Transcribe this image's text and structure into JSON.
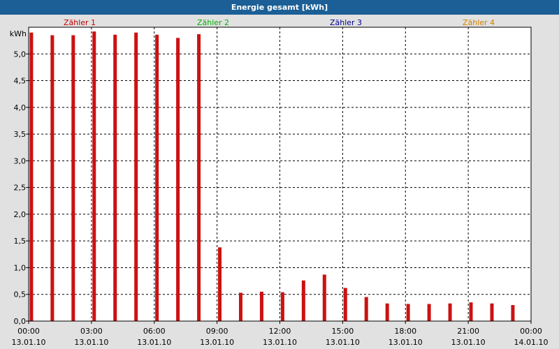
{
  "window": {
    "title": "Energie gesamt [kWh]"
  },
  "legend": [
    {
      "label": "Zähler 1",
      "color": "#c00000"
    },
    {
      "label": "Zähler 2",
      "color": "#00b000"
    },
    {
      "label": "Zähler 3",
      "color": "#000090"
    },
    {
      "label": "Zähler 4",
      "color": "#d08000"
    }
  ],
  "chart_data": {
    "type": "bar",
    "title": "Energie gesamt [kWh]",
    "ylabel": "kWh",
    "ylim": [
      0,
      5.5
    ],
    "ytick_labels": [
      "0,0",
      "0,5",
      "1,0",
      "1,5",
      "2,0",
      "2,5",
      "3,0",
      "3,5",
      "4,0",
      "4,5",
      "5,0"
    ],
    "xtick_labels": [
      {
        "time": "00:00",
        "date": "13.01.10"
      },
      {
        "time": "03:00",
        "date": "13.01.10"
      },
      {
        "time": "06:00",
        "date": "13.01.10"
      },
      {
        "time": "09:00",
        "date": "13.01.10"
      },
      {
        "time": "12:00",
        "date": "13.01.10"
      },
      {
        "time": "15:00",
        "date": "13.01.10"
      },
      {
        "time": "18:00",
        "date": "13.01.10"
      },
      {
        "time": "21:00",
        "date": "13.01.10"
      },
      {
        "time": "00:00",
        "date": "14.01.10"
      }
    ],
    "grid": true,
    "series": [
      {
        "name": "Zähler 1",
        "color": "#cc1111",
        "x": [
          "00:00",
          "01:00",
          "02:00",
          "03:00",
          "04:00",
          "05:00",
          "06:00",
          "07:00",
          "08:00",
          "09:00",
          "10:00",
          "11:00",
          "12:00",
          "13:00",
          "14:00",
          "15:00",
          "16:00",
          "17:00",
          "18:00",
          "19:00",
          "20:00",
          "21:00",
          "22:00",
          "23:00"
        ],
        "values": [
          5.4,
          5.35,
          5.35,
          5.42,
          5.36,
          5.4,
          5.36,
          5.3,
          5.37,
          1.38,
          0.53,
          0.55,
          0.54,
          0.76,
          0.87,
          0.62,
          0.45,
          0.33,
          0.32,
          0.32,
          0.33,
          0.35,
          0.33,
          0.3
        ]
      }
    ]
  }
}
